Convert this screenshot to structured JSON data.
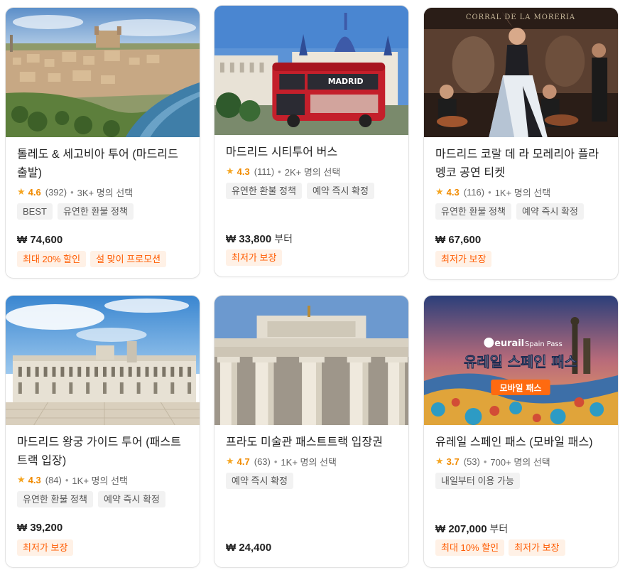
{
  "accent_orange": "#ff5b00",
  "star_color": "#f5a623",
  "cards": [
    {
      "title": "톨레도 & 세고비아 투어 (마드리드 출발)",
      "star": "★",
      "score": "4.6",
      "reviews": "(392)",
      "dot": "•",
      "booked": "3K+ 명의 선택",
      "tags": [
        "BEST",
        "유연한 환불 정책"
      ],
      "price": "₩ 74,600",
      "price_suffix": "",
      "promos": [
        "최대 20% 할인",
        "설 맞이 프로모션"
      ]
    },
    {
      "title": "마드리드 시티투어 버스",
      "star": "★",
      "score": "4.3",
      "reviews": "(111)",
      "dot": "•",
      "booked": "2K+ 명의 선택",
      "tags": [
        "유연한 환불 정책",
        "예약 즉시 확정"
      ],
      "price": "₩ 33,800",
      "price_suffix": "부터",
      "promos": [
        "최저가 보장"
      ],
      "image_text": "MADRID"
    },
    {
      "title": "마드리드 코랄 데 라 모레리아 플라멩코 공연 티켓",
      "star": "★",
      "score": "4.3",
      "reviews": "(116)",
      "dot": "•",
      "booked": "1K+ 명의 선택",
      "tags": [
        "유연한 환불 정책",
        "예약 즉시 확정"
      ],
      "price": "₩ 67,600",
      "price_suffix": "",
      "promos": [
        "최저가 보장"
      ],
      "image_text": "CORRAL DE LA MORERIA"
    },
    {
      "title": "마드리드 왕궁 가이드 투어 (패스트트랙 입장)",
      "star": "★",
      "score": "4.3",
      "reviews": "(84)",
      "dot": "•",
      "booked": "1K+ 명의 선택",
      "tags": [
        "유연한 환불 정책",
        "예약 즉시 확정"
      ],
      "price": "₩ 39,200",
      "price_suffix": "",
      "promos": [
        "최저가 보장"
      ]
    },
    {
      "title": "프라도 미술관 패스트트랙 입장권",
      "star": "★",
      "score": "4.7",
      "reviews": "(63)",
      "dot": "•",
      "booked": "1K+ 명의 선택",
      "tags": [
        "예약 즉시 확정"
      ],
      "price": "₩ 24,400",
      "price_suffix": "",
      "promos": []
    },
    {
      "title": "유레일 스페인 패스 (모바일 패스)",
      "star": "★",
      "score": "3.7",
      "reviews": "(53)",
      "dot": "•",
      "booked": "700+ 명의 선택",
      "tags": [
        "내일부터 이용 가능"
      ],
      "price": "₩ 207,000",
      "price_suffix": "부터",
      "promos": [
        "최대 10% 할인",
        "최저가 보장"
      ],
      "image_brand": "eurail",
      "image_brand_sub": "Spain Pass",
      "image_title": "유레일 스페인 패스",
      "image_badge": "모바일 패스"
    }
  ]
}
